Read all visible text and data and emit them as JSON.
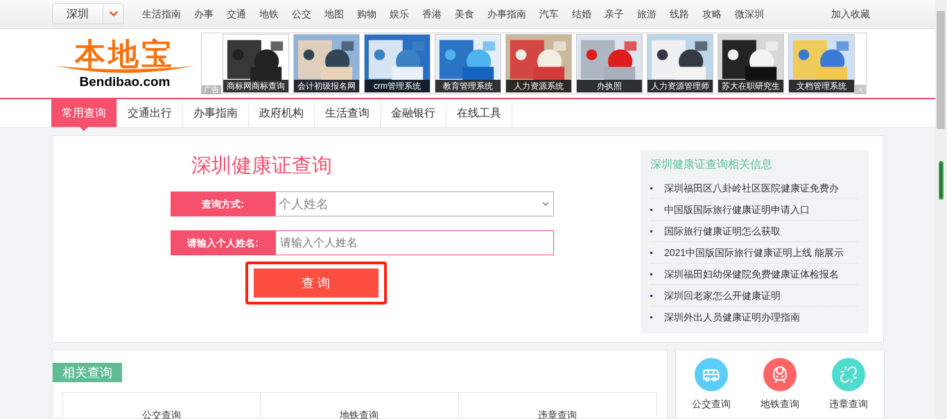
{
  "city_selector": {
    "value": "深圳"
  },
  "top_nav": [
    "生活指南",
    "办事",
    "交通",
    "地铁",
    "公交",
    "地图",
    "购物",
    "娱乐",
    "香港",
    "美食",
    "办事指南",
    "汽车",
    "结婚",
    "亲子",
    "旅游",
    "线路",
    "攻略",
    "微深圳"
  ],
  "bookmark_link": "加入收藏",
  "logo": {
    "name": "本地宝",
    "domain": "Bendibao.com"
  },
  "ads": {
    "label": "广告",
    "items": [
      {
        "caption": "商标网商标查询"
      },
      {
        "caption": "会计初级报名网"
      },
      {
        "caption": "crm管理系统"
      },
      {
        "caption": "教育管理系统"
      },
      {
        "caption": "人力资源系统"
      },
      {
        "caption": "办执照"
      },
      {
        "caption": "人力资源管理师"
      },
      {
        "caption": "苏大在职研究生"
      },
      {
        "caption": "文档管理系统"
      }
    ]
  },
  "tabs": [
    {
      "label": "常用查询",
      "selected": true
    },
    {
      "label": "交通出行",
      "selected": false
    },
    {
      "label": "办事指南",
      "selected": false
    },
    {
      "label": "政府机构",
      "selected": false
    },
    {
      "label": "生活查询",
      "selected": false
    },
    {
      "label": "金融银行",
      "selected": false
    },
    {
      "label": "在线工具",
      "selected": false
    }
  ],
  "query": {
    "title": "深圳健康证查询",
    "fields": [
      {
        "kind": "select",
        "label": "查询方式:",
        "value": "个人姓名"
      },
      {
        "kind": "input",
        "label": "请输入个人姓名:",
        "placeholder": "请输入个人姓名"
      }
    ],
    "submit": "查 询"
  },
  "related_info": {
    "title": "深圳健康证查询相关信息",
    "items": [
      "深圳福田区八卦岭社区医院健康证免费办",
      "中国版国际旅行健康证明申请入口",
      "国际旅行健康证明怎么获取",
      "2021中国版国际旅行健康证明上线 能展示",
      "深圳福田妇幼保健院免费健康证体检报名",
      "深圳回老家怎么开健康证明",
      "深圳外出人员健康证明办理指南"
    ]
  },
  "related_queries": {
    "title": "相关查询",
    "cells": [
      "公交查询",
      "地铁查询",
      "违章查询"
    ]
  },
  "shortcuts": [
    {
      "kind": "bus",
      "label": "公交查询",
      "color": "#5bcdfa"
    },
    {
      "kind": "train",
      "label": "地铁查询",
      "color": "#fe6464"
    },
    {
      "kind": "link",
      "label": "违章查询",
      "color": "#4fdccc"
    }
  ]
}
